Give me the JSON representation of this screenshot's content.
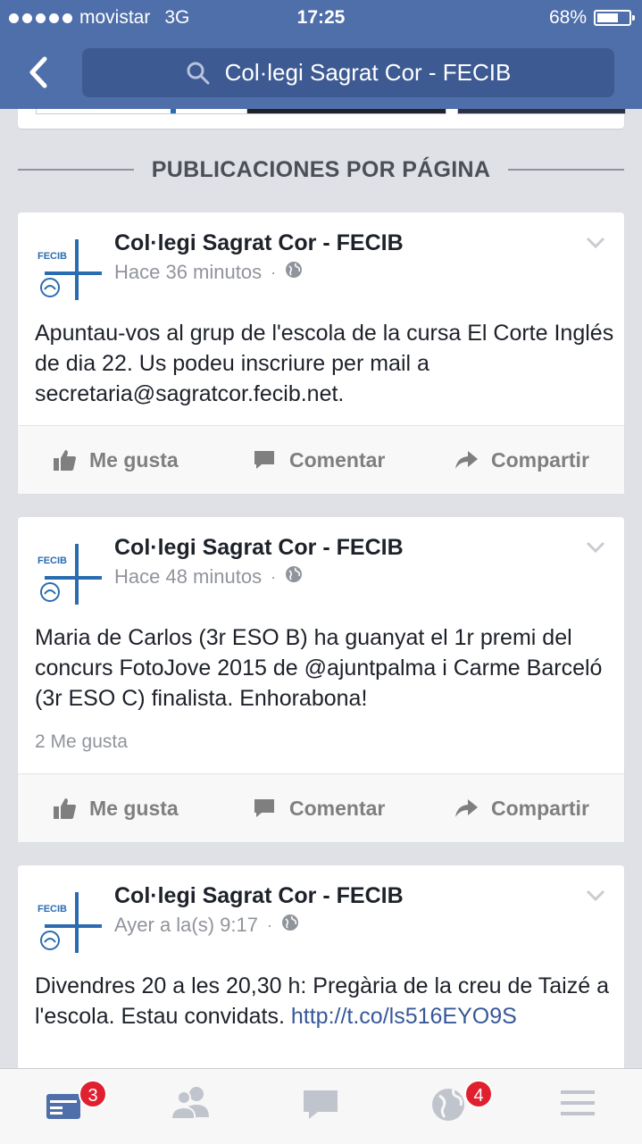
{
  "status_bar": {
    "carrier": "movistar",
    "network": "3G",
    "time": "17:25",
    "battery": "68%",
    "battery_level": 0.68
  },
  "header": {
    "search_text": "Col·legi Sagrat Cor - FECIB"
  },
  "section": {
    "title": "PUBLICACIONES POR PÁGINA"
  },
  "posts": [
    {
      "author": "Col·legi Sagrat Cor - FECIB",
      "time": "Hace 36 minutos",
      "separator": "·",
      "text": "Apuntau-vos al grup de l'escola de la cursa El Corte Inglés de dia 22. Us podeu inscriure per mail a secretaria@sagratcor.fecib.net.",
      "like_label": "Me gusta",
      "comment_label": "Comentar",
      "share_label": "Compartir"
    },
    {
      "author": "Col·legi Sagrat Cor - FECIB",
      "time": "Hace 48 minutos",
      "separator": "·",
      "text": "Maria de Carlos (3r ESO B) ha guanyat el 1r premi del concurs FotoJove 2015 de @ajuntpalma i Carme Barceló (3r ESO C) finalista. Enhorabona!",
      "likes_count": "2 Me gusta",
      "like_label": "Me gusta",
      "comment_label": "Comentar",
      "share_label": "Compartir"
    },
    {
      "author": "Col·legi Sagrat Cor - FECIB",
      "time": "Ayer a la(s) 9:17",
      "separator": "·",
      "text": "Divendres 20 a les 20,30 h: Pregària de la creu de Taizé a l'escola. Estau convidats. ",
      "link": "http://t.co/ls516EYO9S"
    }
  ],
  "avatar_logo_text": "FECIB",
  "tabbar": {
    "news_feed_badge": "3",
    "notifications_badge": "4"
  },
  "colors": {
    "header": "#4f6faa",
    "search_bg": "#3e5a92",
    "link": "#365899",
    "badge": "#e0202e"
  }
}
